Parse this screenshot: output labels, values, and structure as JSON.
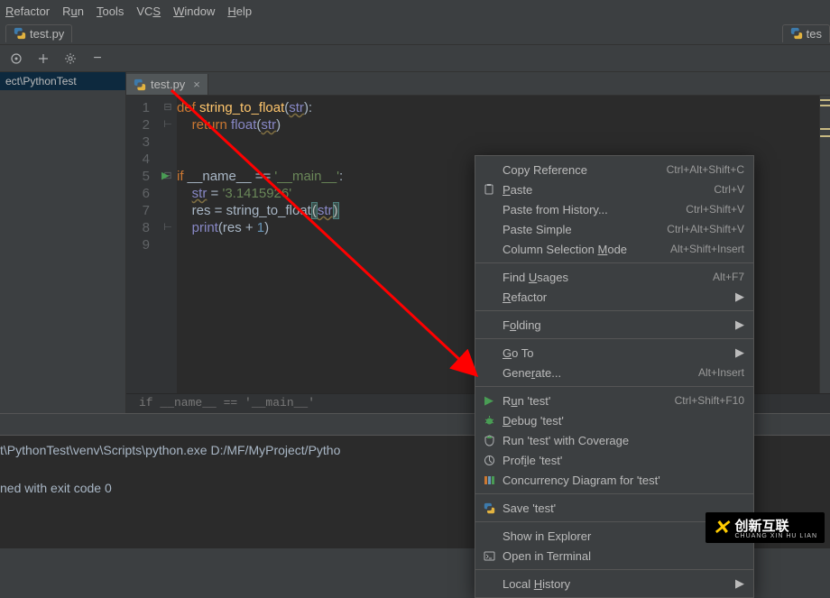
{
  "menubar": {
    "items": [
      "Refactor",
      "Run",
      "Tools",
      "VCS",
      "Window",
      "Help"
    ],
    "underline_idx": [
      0,
      1,
      0,
      2,
      0,
      0
    ]
  },
  "top_tab": {
    "file": "test.py"
  },
  "right_tab": {
    "file": "tes"
  },
  "sidebar": {
    "project": "ect\\PythonTest"
  },
  "editor_tab": {
    "file": "test.py"
  },
  "code": {
    "l1": "def string_to_float(str):",
    "l2": "    return float(str)",
    "l3": "",
    "l4": "",
    "l5": "if __name__ == '__main__':",
    "l6": "    str = '3.1415926'",
    "l7": "    res = string_to_float(str)",
    "l8": "    print(res + 1)",
    "l9": ""
  },
  "gutter": {
    "lines": [
      "1",
      "2",
      "3",
      "4",
      "5",
      "6",
      "7",
      "8",
      "9"
    ]
  },
  "breadcrumb": "if __name__ == '__main__'",
  "console": {
    "l1": "t\\PythonTest\\venv\\Scripts\\python.exe D:/MF/MyProject/Pytho",
    "l2": "",
    "l3": "ned with exit code 0"
  },
  "context_menu": {
    "copy_ref": {
      "label": "Copy Reference",
      "shortcut": "Ctrl+Alt+Shift+C"
    },
    "paste": {
      "label": "Paste",
      "shortcut": "Ctrl+V"
    },
    "paste_hist": {
      "label": "Paste from History...",
      "shortcut": "Ctrl+Shift+V"
    },
    "paste_simple": {
      "label": "Paste Simple",
      "shortcut": "Ctrl+Alt+Shift+V"
    },
    "col_sel": {
      "label": "Column Selection Mode",
      "shortcut": "Alt+Shift+Insert"
    },
    "find_usages": {
      "label": "Find Usages",
      "shortcut": "Alt+F7"
    },
    "refactor": {
      "label": "Refactor"
    },
    "folding": {
      "label": "Folding"
    },
    "goto": {
      "label": "Go To"
    },
    "generate": {
      "label": "Generate...",
      "shortcut": "Alt+Insert"
    },
    "run": {
      "label": "Run 'test'",
      "shortcut": "Ctrl+Shift+F10"
    },
    "debug": {
      "label": "Debug 'test'"
    },
    "coverage": {
      "label": "Run 'test' with Coverage"
    },
    "profile": {
      "label": "Profile 'test'"
    },
    "concurrency": {
      "label": "Concurrency Diagram for 'test'"
    },
    "save": {
      "label": "Save 'test'"
    },
    "explorer": {
      "label": "Show in Explorer"
    },
    "terminal": {
      "label": "Open in Terminal"
    },
    "local_history": {
      "label": "Local History"
    }
  },
  "watermark": {
    "brand": "创新互联",
    "sub": "CHUANG XIN HU LIAN"
  }
}
